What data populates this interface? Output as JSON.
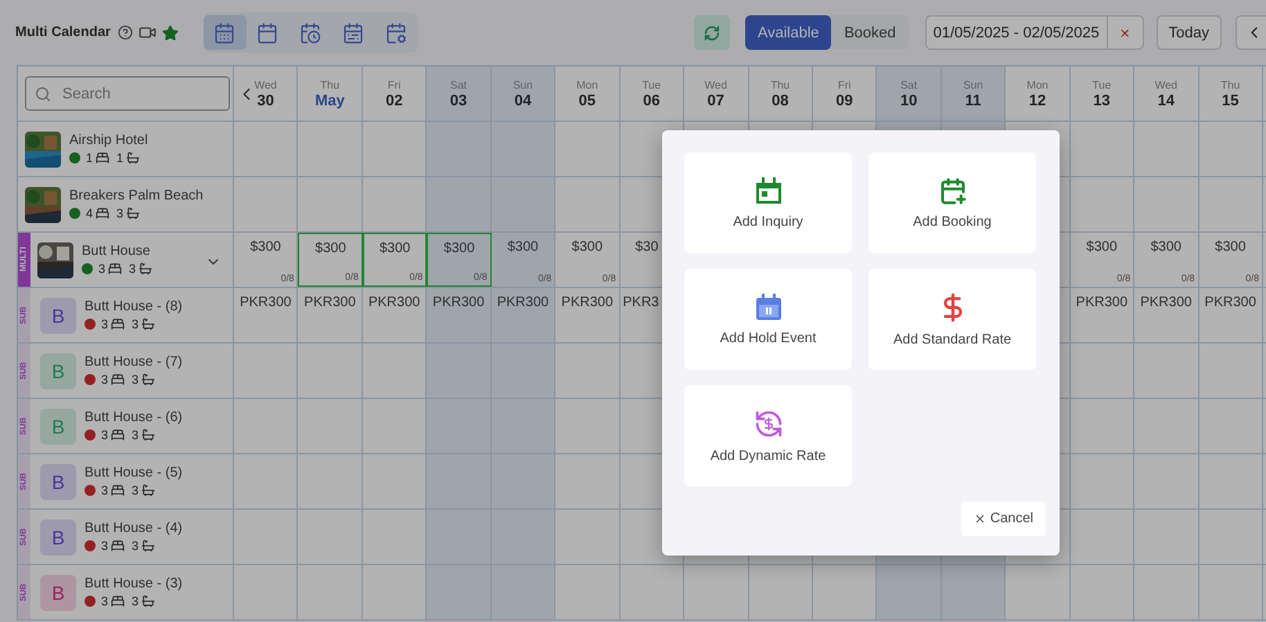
{
  "header": {
    "title": "Multi Calendar",
    "view_buttons": [
      {
        "selected": true
      },
      {
        "selected": false
      },
      {
        "selected": false
      },
      {
        "selected": false
      },
      {
        "selected": false
      }
    ],
    "filter": [
      {
        "label": "Available",
        "selected": true
      },
      {
        "label": "Booked",
        "selected": false
      }
    ],
    "date_range": "01/05/2025 - 02/05/2025",
    "clear": "×",
    "today": "Today"
  },
  "search": {
    "placeholder": "Search"
  },
  "days": [
    {
      "weekday": "Wed",
      "day": "30",
      "weekend": false,
      "month_start": false
    },
    {
      "weekday": "Thu",
      "day": "May",
      "weekend": false,
      "month_start": true
    },
    {
      "weekday": "Fri",
      "day": "02",
      "weekend": false,
      "month_start": false
    },
    {
      "weekday": "Sat",
      "day": "03",
      "weekend": true,
      "month_start": false
    },
    {
      "weekday": "Sun",
      "day": "04",
      "weekend": true,
      "month_start": false
    },
    {
      "weekday": "Mon",
      "day": "05",
      "weekend": false,
      "month_start": false
    },
    {
      "weekday": "Tue",
      "day": "06",
      "weekend": false,
      "month_start": false
    },
    {
      "weekday": "Wed",
      "day": "07",
      "weekend": false,
      "month_start": false
    },
    {
      "weekday": "Thu",
      "day": "08",
      "weekend": false,
      "month_start": false
    },
    {
      "weekday": "Fri",
      "day": "09",
      "weekend": false,
      "month_start": false
    },
    {
      "weekday": "Sat",
      "day": "10",
      "weekend": true,
      "month_start": false
    },
    {
      "weekday": "Sun",
      "day": "11",
      "weekend": true,
      "month_start": false
    },
    {
      "weekday": "Mon",
      "day": "12",
      "weekend": false,
      "month_start": false
    },
    {
      "weekday": "Tue",
      "day": "13",
      "weekend": false,
      "month_start": false
    },
    {
      "weekday": "Wed",
      "day": "14",
      "weekend": false,
      "month_start": false
    },
    {
      "weekday": "Thu",
      "day": "15",
      "weekend": false,
      "month_start": false
    }
  ],
  "rows": [
    {
      "kind": "property",
      "name": "Airship Hotel",
      "status": {
        "color": "#156120"
      },
      "beds": "1",
      "baths": "1"
    },
    {
      "kind": "property",
      "name": "Breakers Palm Beach",
      "status": {
        "color": "#156120"
      },
      "beds": "4",
      "baths": "3"
    },
    {
      "kind": "multi",
      "tag": "MULTI",
      "name": "Butt House",
      "status": {
        "color": "#156120"
      },
      "beds": "3",
      "baths": "3",
      "cells": [
        {
          "price": "$300",
          "occupancy": "0/8",
          "selected": false
        },
        {
          "price": "$300",
          "occupancy": "0/8",
          "selected": true
        },
        {
          "price": "$300",
          "occupancy": "0/8",
          "selected": true
        },
        {
          "price": "$300",
          "occupancy": "0/8",
          "selected": true
        },
        {
          "price": "$300",
          "occupancy": "0/8",
          "selected": false
        },
        {
          "price": "$300",
          "occupancy": "0/8",
          "selected": false
        },
        {
          "price": "$30",
          "selected": false,
          "clipped": true
        },
        null,
        null,
        null,
        null,
        null,
        null,
        {
          "price": "$300",
          "occupancy": "0/8",
          "selected": false
        },
        {
          "price": "$300",
          "occupancy": "0/8",
          "selected": false
        },
        {
          "price": "$300",
          "occupancy": "0/8",
          "selected": false
        }
      ]
    },
    {
      "kind": "sub",
      "tag": "SUB",
      "avatar": {
        "letter": "B",
        "color": "#4a3796"
      },
      "name": "Butt House - (8)",
      "status": {
        "color": "#942121"
      },
      "beds": "3",
      "baths": "3",
      "cells": [
        {
          "price": "PKR300"
        },
        {
          "price": "PKR300"
        },
        {
          "price": "PKR300"
        },
        {
          "price": "PKR300"
        },
        {
          "price": "PKR300"
        },
        {
          "price": "PKR300"
        },
        {
          "price": "PKR3",
          "clipped": true
        },
        null,
        null,
        null,
        null,
        null,
        null,
        {
          "price": "PKR300"
        },
        {
          "price": "PKR300"
        },
        {
          "price": "PKR300"
        }
      ]
    },
    {
      "kind": "sub",
      "tag": "SUB",
      "avatar": {
        "letter": "B",
        "color": "#217a56"
      },
      "name": "Butt House - (7)",
      "status": {
        "color": "#942121"
      },
      "beds": "3",
      "baths": "3"
    },
    {
      "kind": "sub",
      "tag": "SUB",
      "avatar": {
        "letter": "B",
        "color": "#217a56"
      },
      "name": "Butt House - (6)",
      "status": {
        "color": "#942121"
      },
      "beds": "3",
      "baths": "3"
    },
    {
      "kind": "sub",
      "tag": "SUB",
      "avatar": {
        "letter": "B",
        "color": "#4a3796"
      },
      "name": "Butt House - (5)",
      "status": {
        "color": "#942121"
      },
      "beds": "3",
      "baths": "3"
    },
    {
      "kind": "sub",
      "tag": "SUB",
      "avatar": {
        "letter": "B",
        "color": "#4a3796"
      },
      "name": "Butt House - (4)",
      "status": {
        "color": "#942121"
      },
      "beds": "3",
      "baths": "3"
    },
    {
      "kind": "sub",
      "tag": "SUB",
      "avatar": {
        "letter": "B",
        "color": "#96245c"
      },
      "name": "Butt House - (3)",
      "status": {
        "color": "#942121"
      },
      "beds": "3",
      "baths": "3"
    }
  ],
  "dialog": {
    "actions": [
      {
        "kind": "inquiry",
        "label": "Add Inquiry"
      },
      {
        "kind": "booking",
        "label": "Add Booking"
      },
      {
        "kind": "hold",
        "label": "Add Hold Event"
      },
      {
        "kind": "standard_rate",
        "label": "Add Standard Rate"
      },
      {
        "kind": "dynamic_rate",
        "label": "Add Dynamic Rate"
      }
    ],
    "cancel": "Cancel"
  }
}
